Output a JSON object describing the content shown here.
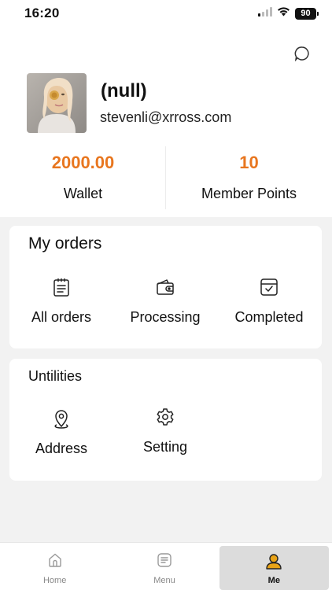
{
  "status_bar": {
    "time": "16:20",
    "battery": "90"
  },
  "profile": {
    "name": "(null)",
    "email": "stevenli@xrross.com",
    "stats": [
      {
        "value": "2000.00",
        "label": "Wallet"
      },
      {
        "value": "10",
        "label": "Member Points"
      }
    ]
  },
  "orders": {
    "title": "My orders",
    "items": [
      {
        "label": "All orders",
        "icon": "clipboard-list-icon"
      },
      {
        "label": "Processing",
        "icon": "wallet-icon"
      },
      {
        "label": "Completed",
        "icon": "completed-box-icon"
      }
    ]
  },
  "utilities": {
    "title": "Untilities",
    "items": [
      {
        "label": "Address",
        "icon": "location-pin-icon"
      },
      {
        "label": "Setting",
        "icon": "gear-icon"
      }
    ]
  },
  "tab_bar": {
    "tabs": [
      {
        "label": "Home",
        "icon": "home-icon",
        "active": false
      },
      {
        "label": "Menu",
        "icon": "menu-icon",
        "active": false
      },
      {
        "label": "Me",
        "icon": "user-icon",
        "active": true
      }
    ]
  },
  "colors": {
    "accent": "#e8761f",
    "active_icon": "#e8a317"
  }
}
